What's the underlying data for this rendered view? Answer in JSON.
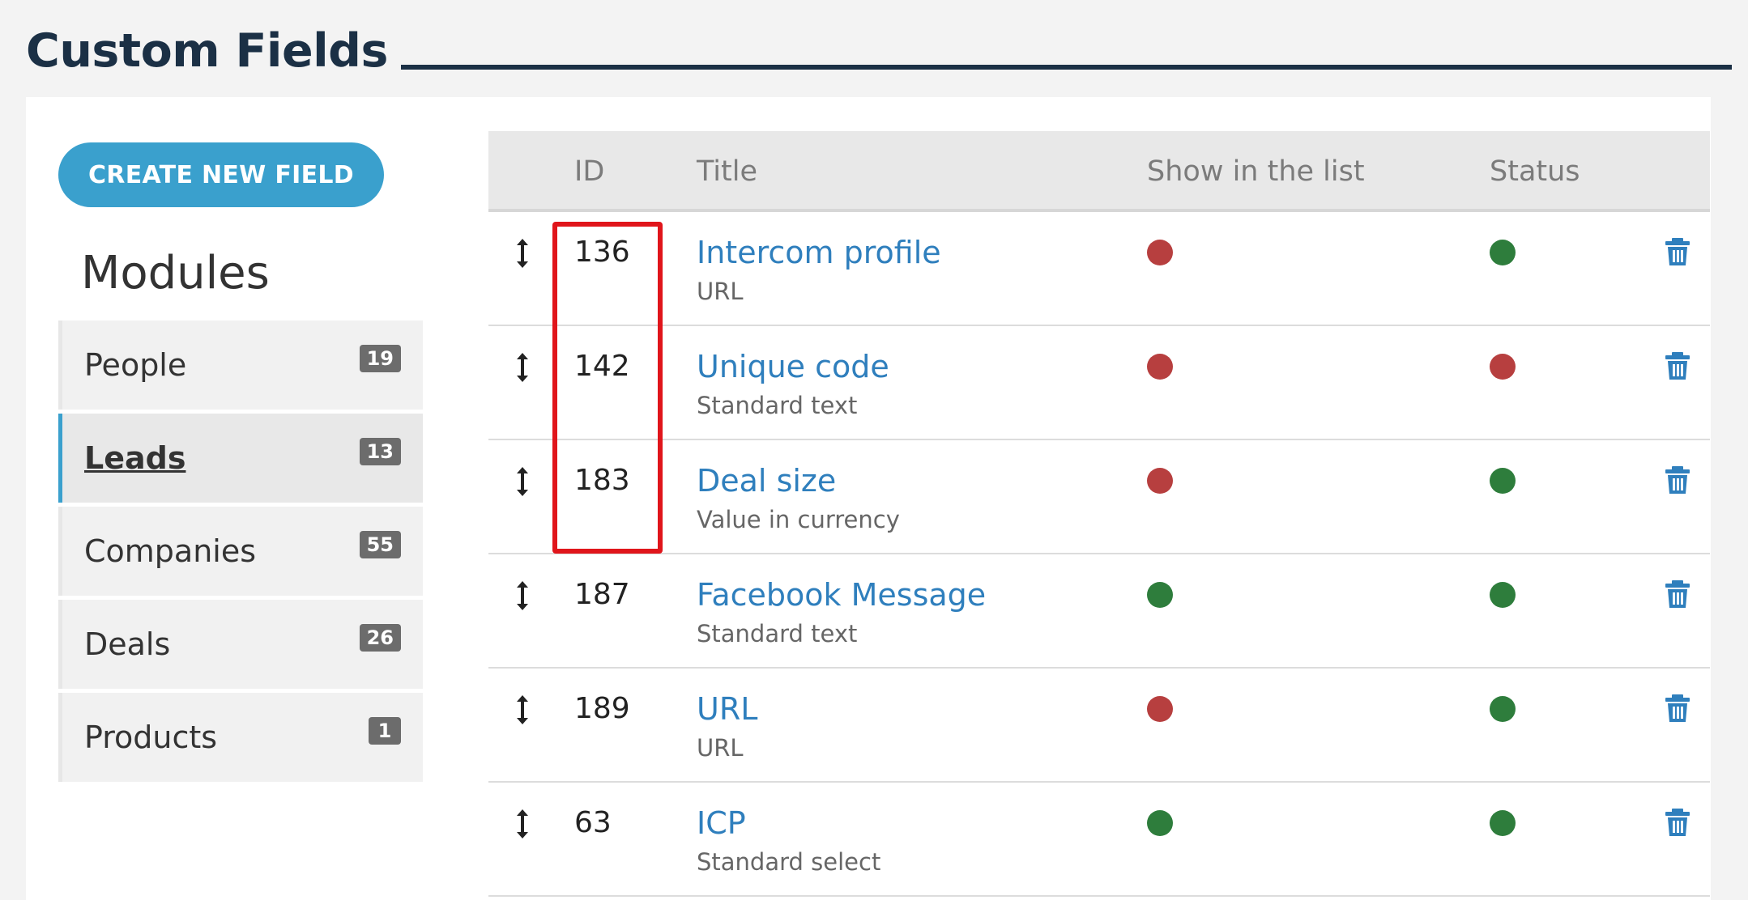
{
  "header": {
    "title": "Custom Fields"
  },
  "toolbar": {
    "create_label": "CREATE NEW FIELD"
  },
  "sidebar": {
    "heading": "Modules",
    "items": [
      {
        "label": "People",
        "count": "19",
        "active": false
      },
      {
        "label": "Leads",
        "count": "13",
        "active": true
      },
      {
        "label": "Companies",
        "count": "55",
        "active": false
      },
      {
        "label": "Deals",
        "count": "26",
        "active": false
      },
      {
        "label": "Products",
        "count": "1",
        "active": false
      }
    ]
  },
  "table": {
    "columns": {
      "id": "ID",
      "title": "Title",
      "show": "Show in the list",
      "status": "Status"
    },
    "rows": [
      {
        "id": "136",
        "title": "Intercom profile",
        "type": "URL",
        "show_in_list": false,
        "status": true
      },
      {
        "id": "142",
        "title": "Unique code",
        "type": "Standard text",
        "show_in_list": false,
        "status": false
      },
      {
        "id": "183",
        "title": "Deal size",
        "type": "Value in currency",
        "show_in_list": false,
        "status": true
      },
      {
        "id": "187",
        "title": "Facebook Message",
        "type": "Standard text",
        "show_in_list": true,
        "status": true
      },
      {
        "id": "189",
        "title": "URL",
        "type": "URL",
        "show_in_list": false,
        "status": true
      },
      {
        "id": "63",
        "title": "ICP",
        "type": "Standard select",
        "show_in_list": true,
        "status": true
      }
    ]
  },
  "icons": {
    "drag": "drag-handle-icon",
    "delete": "trash-icon",
    "indicator": "status-dot-icon"
  },
  "colors": {
    "accent": "#3aa0cd",
    "link": "#2f7fbd",
    "on": "#2e7d3c",
    "off": "#b73f3f",
    "highlight": "#e0151b",
    "title": "#1b3045"
  }
}
